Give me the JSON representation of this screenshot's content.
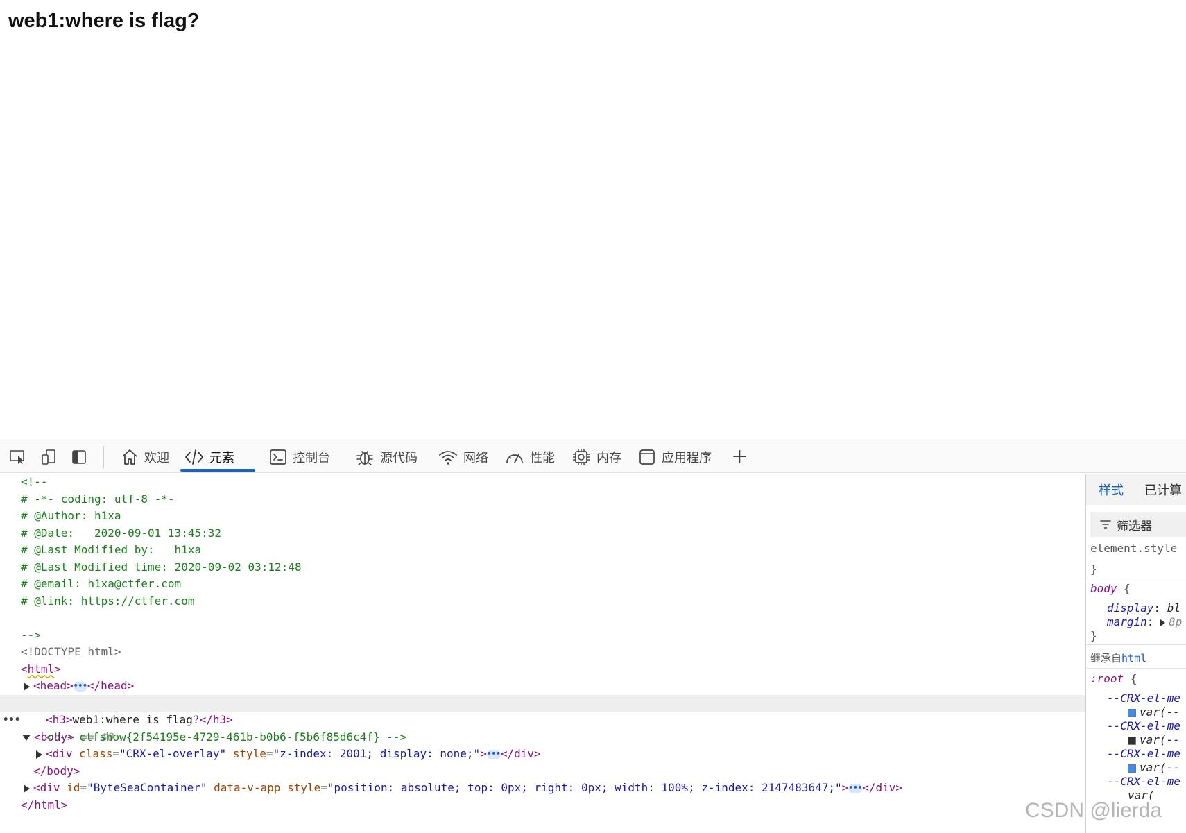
{
  "page": {
    "heading": "web1:where is flag?"
  },
  "toolbar": {
    "icons": [
      "inspect-element-icon",
      "device-emulation-icon",
      "dock-side-icon"
    ],
    "tabs": [
      {
        "label": "欢迎",
        "icon": "home-icon"
      },
      {
        "label": "元素",
        "icon": "code-icon",
        "active": true
      },
      {
        "label": "控制台",
        "icon": "console-icon"
      },
      {
        "label": "源代码",
        "icon": "bug-icon"
      },
      {
        "label": "网络",
        "icon": "wifi-icon"
      },
      {
        "label": "性能",
        "icon": "gauge-icon"
      },
      {
        "label": "内存",
        "icon": "chip-icon"
      },
      {
        "label": "应用程序",
        "icon": "app-window-icon"
      }
    ],
    "add_tab": "+"
  },
  "dom": {
    "comment_lines": [
      "<!--",
      "# -*- coding: utf-8 -*-",
      "# @Author: h1xa",
      "# @Date:   2020-09-01 13:45:32",
      "# @Last Modified by:   h1xa",
      "# @Last Modified time: 2020-09-02 03:12:48",
      "# @email: h1xa@ctfer.com",
      "# @link: https://ctfer.com",
      "",
      "-->"
    ],
    "doctype": "<!DOCTYPE html>",
    "html_open": "html",
    "head": "head",
    "body": "body",
    "selected_marker": "== $0",
    "h3_text": "web1:where is flag?",
    "flag_comment": "<!-- ctfshow{2f54195e-4729-461b-b0b6-f5b6f85d6c4f} -->",
    "overlay_div": {
      "class_attr": "class",
      "class_val": "\"CRX-el-overlay\"",
      "style_attr": "style",
      "style_val": "\"z-index: 2001; display: none;\""
    },
    "bytesea_div": {
      "id_attr": "id",
      "id_val": "\"ByteSeaContainer\"",
      "data_attr": "data-v-app",
      "style_attr": "style",
      "style_val": "\"position: absolute; top: 0px; right: 0px; width: 100%; z-index: 2147483647;\""
    },
    "ellipsis": "•••"
  },
  "styles_pane": {
    "tabs": [
      "样式",
      "已计算"
    ],
    "filter_label": "筛选器",
    "element_style": "element.style",
    "close_brace": "}",
    "body_selector": "body",
    "open_brace": "{",
    "body_props": [
      {
        "name": "display",
        "value": "bl"
      },
      {
        "name": "margin",
        "value": "8p"
      }
    ],
    "inherited_from": "继承自",
    "inherited_link": "html",
    "root_selector": ":root",
    "root_props": [
      {
        "name": "--CRX-el-me",
        "value": "var(--",
        "swatch": "#3b8ff0"
      },
      {
        "name": "--CRX-el-me",
        "value": "var(--",
        "swatch": "#333333"
      },
      {
        "name": "--CRX-el-me",
        "value": "var(--",
        "swatch": "#3b8ff0"
      },
      {
        "name": "--CRX-el-me",
        "value": "var(",
        "swatch": null
      }
    ]
  },
  "watermark": "CSDN @lierda"
}
